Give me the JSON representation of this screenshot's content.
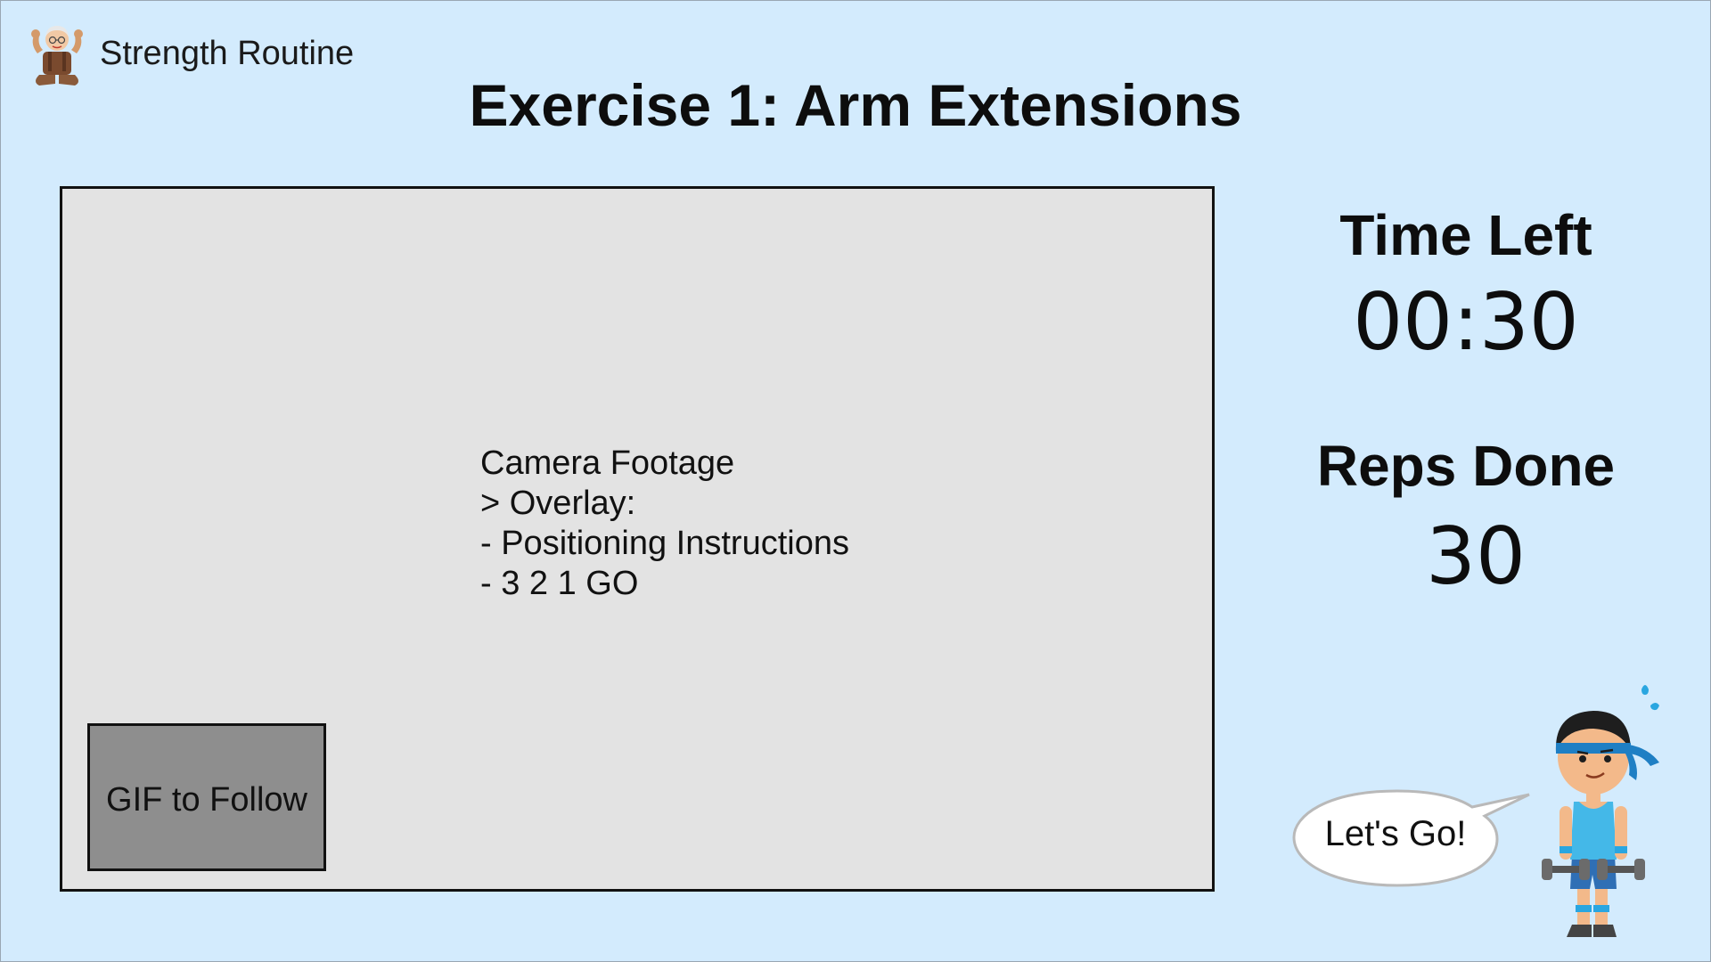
{
  "app": {
    "title": "Strength Routine",
    "logo_icon": "grandparent-flexing-icon"
  },
  "exercise": {
    "title": "Exercise 1: Arm Extensions"
  },
  "camera": {
    "lines": [
      "Camera Footage",
      "> Overlay:",
      "- Positioning Instructions",
      "- 3 2 1 GO"
    ],
    "gif_label": "GIF to Follow"
  },
  "stats": {
    "time_left_label": "Time Left",
    "time_left_value": "00:30",
    "reps_done_label": "Reps Done",
    "reps_done_value": "30"
  },
  "mascot": {
    "speech": "Let's Go!",
    "icon": "athlete-with-dumbbells-icon"
  },
  "colors": {
    "background": "#d3ebfd",
    "camera_panel": "#e3e3e3",
    "gif_box": "#8e8e8e",
    "headband": "#1f7fc4",
    "shirt": "#44b8e8"
  }
}
